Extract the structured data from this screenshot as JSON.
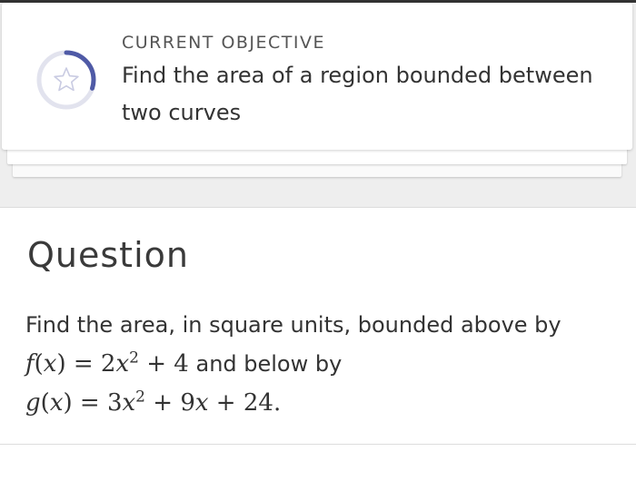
{
  "objective": {
    "heading": "CURRENT OBJECTIVE",
    "text": "Find the area of a region bounded between two curves",
    "progress_fraction": 0.3,
    "icon": "star-icon",
    "accent_color": "#4f5aa6"
  },
  "question": {
    "heading": "Question",
    "intro": "Find the area, in square units, bounded above by",
    "f_name": "f",
    "f_var": "x",
    "f_rhs_coef": "2",
    "f_rhs_var": "x",
    "f_rhs_exp": "2",
    "f_rhs_const": "4",
    "connector": "and below by",
    "g_name": "g",
    "g_var": "x",
    "g_rhs_coef": "3",
    "g_rhs_var": "x",
    "g_rhs_exp": "2",
    "g_rhs_coef2": "9",
    "g_rhs_var2": "x",
    "g_rhs_const": "24"
  }
}
